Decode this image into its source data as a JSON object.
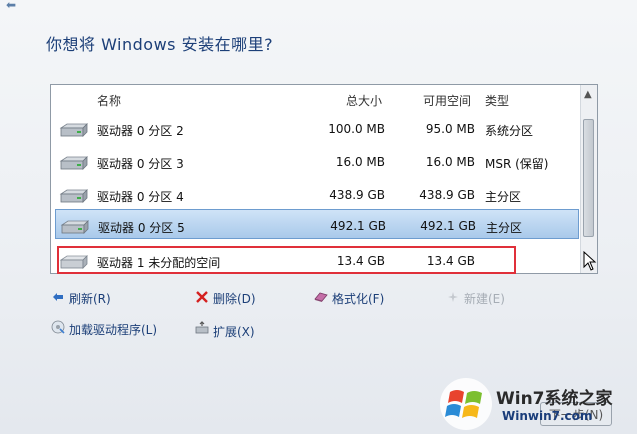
{
  "window": {
    "title": "你想将 Windows 安装在哪里?",
    "back_arrow": "⬅"
  },
  "list": {
    "headers": {
      "name": "名称",
      "total": "总大小",
      "free": "可用空间",
      "type": "类型"
    },
    "rows": [
      {
        "name": "驱动器 0 分区 2",
        "total": "100.0 MB",
        "free": "95.0 MB",
        "type": "系统分区"
      },
      {
        "name": "驱动器 0 分区 3",
        "total": "16.0 MB",
        "free": "16.0 MB",
        "type": "MSR (保留)"
      },
      {
        "name": "驱动器 0 分区 4",
        "total": "438.9 GB",
        "free": "438.9 GB",
        "type": "主分区"
      },
      {
        "name": "驱动器 0 分区 5",
        "total": "492.1 GB",
        "free": "492.1 GB",
        "type": "主分区"
      },
      {
        "name": "驱动器 1 未分配的空间",
        "total": "13.4 GB",
        "free": "13.4 GB",
        "type": ""
      }
    ],
    "selected_row": 3,
    "scroll_up_icon": "▲"
  },
  "actions": {
    "refresh": "刷新(R)",
    "delete": "删除(D)",
    "format": "格式化(F)",
    "new": "新建(E)",
    "load_driver": "加载驱动程序(L)",
    "extend": "扩展(X)"
  },
  "buttons": {
    "next": "下一步(N)"
  },
  "watermark": {
    "brand_win": "Win7",
    "brand_rest": "系统之家",
    "url": "Winwin7.com"
  },
  "colors": {
    "title": "#1c3f78",
    "selection": "#a9c9ea",
    "highlight": "#e0303a"
  }
}
